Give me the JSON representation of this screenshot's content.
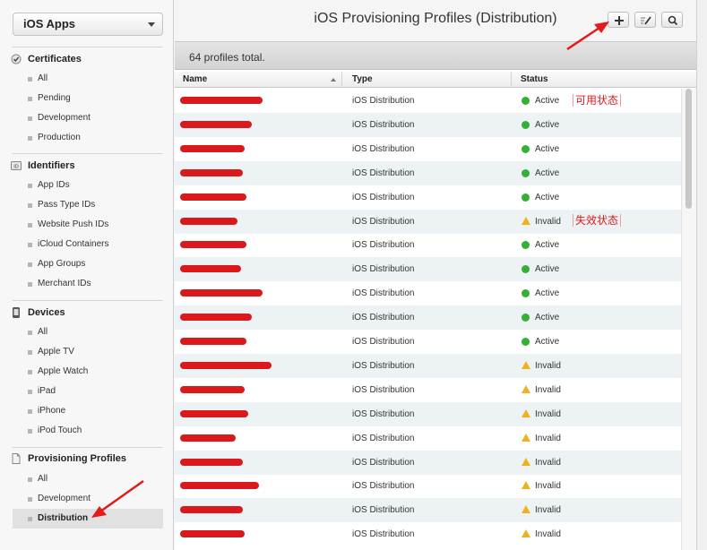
{
  "sidebar": {
    "platform": "iOS Apps",
    "sections": [
      {
        "title": "Certificates",
        "icon": "certificate-check-icon",
        "items": [
          "All",
          "Pending",
          "Development",
          "Production"
        ]
      },
      {
        "title": "Identifiers",
        "icon": "id-badge-icon",
        "items": [
          "App IDs",
          "Pass Type IDs",
          "Website Push IDs",
          "iCloud Containers",
          "App Groups",
          "Merchant IDs"
        ]
      },
      {
        "title": "Devices",
        "icon": "device-icon",
        "items": [
          "All",
          "Apple TV",
          "Apple Watch",
          "iPad",
          "iPhone",
          "iPod Touch"
        ]
      },
      {
        "title": "Provisioning Profiles",
        "icon": "document-icon",
        "items": [
          "All",
          "Development",
          "Distribution"
        ]
      }
    ]
  },
  "header": {
    "title": "iOS Provisioning Profiles (Distribution)"
  },
  "toolbar": {
    "add_icon": "plus-icon",
    "edit_icon": "edit-icon",
    "search_icon": "search-icon"
  },
  "summary": "64 profiles total.",
  "table": {
    "columns": [
      "Name",
      "Type",
      "Status"
    ],
    "rows": [
      {
        "type": "iOS Distribution",
        "status": "Active"
      },
      {
        "type": "iOS Distribution",
        "status": "Active"
      },
      {
        "type": "iOS Distribution",
        "status": "Active"
      },
      {
        "type": "iOS Distribution",
        "status": "Active"
      },
      {
        "type": "iOS Distribution",
        "status": "Active"
      },
      {
        "type": "iOS Distribution",
        "status": "Invalid"
      },
      {
        "type": "iOS Distribution",
        "status": "Active"
      },
      {
        "type": "iOS Distribution",
        "status": "Active"
      },
      {
        "type": "iOS Distribution",
        "status": "Active"
      },
      {
        "type": "iOS Distribution",
        "status": "Active"
      },
      {
        "type": "iOS Distribution",
        "status": "Active"
      },
      {
        "type": "iOS Distribution",
        "status": "Invalid"
      },
      {
        "type": "iOS Distribution",
        "status": "Invalid"
      },
      {
        "type": "iOS Distribution",
        "status": "Invalid"
      },
      {
        "type": "iOS Distribution",
        "status": "Invalid"
      },
      {
        "type": "iOS Distribution",
        "status": "Invalid"
      },
      {
        "type": "iOS Distribution",
        "status": "Invalid"
      },
      {
        "type": "iOS Distribution",
        "status": "Invalid"
      },
      {
        "type": "iOS Distribution",
        "status": "Invalid"
      }
    ]
  },
  "annotations": {
    "active_note": "可用状态",
    "invalid_note": "失效状态"
  },
  "colors": {
    "annotation": "#e21a1a",
    "active": "#34b036",
    "invalid": "#f0b21c",
    "redaction": "#d9191b"
  }
}
